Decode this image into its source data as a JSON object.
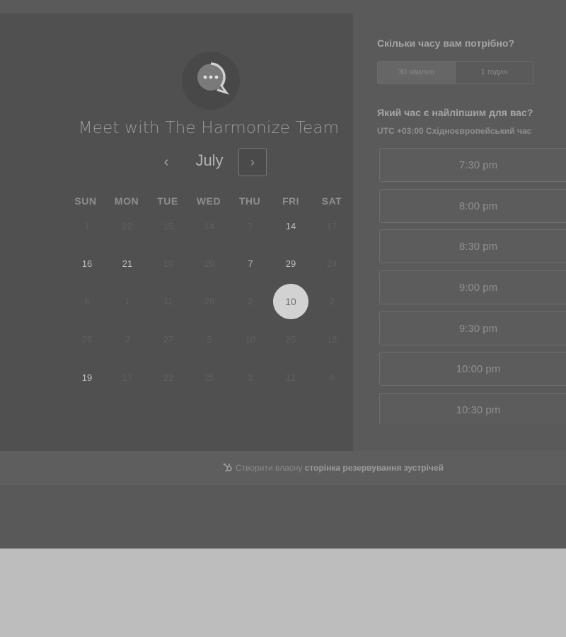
{
  "colors": {
    "left_panel_bg": "#505050",
    "right_panel_bg": "#5a5a5a",
    "selected_day_bg": "#d2d2d2",
    "page_bg": "#bdbdbd"
  },
  "logo": {
    "icon": "chat-bubble-icon"
  },
  "meeting": {
    "title": "Meet with The Harmonize Team"
  },
  "calendar": {
    "month": "July",
    "prev_icon": "chevron-left-icon",
    "next_icon": "chevron-right-icon",
    "prev_glyph": "‹",
    "next_glyph": "›",
    "weekdays": [
      "SUN",
      "MON",
      "TUE",
      "WED",
      "THU",
      "FRI",
      "SAT"
    ],
    "weeks": [
      [
        {
          "label": "1",
          "state": "unavailable"
        },
        {
          "label": "22",
          "state": "unavailable"
        },
        {
          "label": "15",
          "state": "unavailable"
        },
        {
          "label": "14",
          "state": "unavailable"
        },
        {
          "label": "7",
          "state": "unavailable"
        },
        {
          "label": "14",
          "state": "available"
        },
        {
          "label": "17",
          "state": "unavailable"
        }
      ],
      [
        {
          "label": "16",
          "state": "available"
        },
        {
          "label": "21",
          "state": "available"
        },
        {
          "label": "10",
          "state": "unavailable"
        },
        {
          "label": "29",
          "state": "unavailable"
        },
        {
          "label": "7",
          "state": "available"
        },
        {
          "label": "29",
          "state": "available"
        },
        {
          "label": "24",
          "state": "unavailable"
        }
      ],
      [
        {
          "label": "6",
          "state": "unavailable"
        },
        {
          "label": "1",
          "state": "unavailable"
        },
        {
          "label": "11",
          "state": "unavailable"
        },
        {
          "label": "28",
          "state": "unavailable"
        },
        {
          "label": "2",
          "state": "unavailable"
        },
        {
          "label": "10",
          "state": "selected"
        },
        {
          "label": "2",
          "state": "unavailable"
        }
      ],
      [
        {
          "label": "26",
          "state": "unavailable"
        },
        {
          "label": "2",
          "state": "unavailable"
        },
        {
          "label": "27",
          "state": "unavailable"
        },
        {
          "label": "5",
          "state": "unavailable"
        },
        {
          "label": "10",
          "state": "unavailable"
        },
        {
          "label": "25",
          "state": "unavailable"
        },
        {
          "label": "18",
          "state": "unavailable"
        }
      ],
      [
        {
          "label": "19",
          "state": "available"
        },
        {
          "label": "17",
          "state": "unavailable"
        },
        {
          "label": "22",
          "state": "unavailable"
        },
        {
          "label": "25",
          "state": "unavailable"
        },
        {
          "label": "3",
          "state": "unavailable"
        },
        {
          "label": "12",
          "state": "unavailable"
        },
        {
          "label": "4",
          "state": "unavailable"
        }
      ]
    ]
  },
  "duration": {
    "heading": "Скільки часу вам потрібно?",
    "options": [
      "30 хвилин",
      "1 годин"
    ],
    "selected": "30 хвилин"
  },
  "times": {
    "heading": "Який час є найліпшим для вас?",
    "timezone": "UTC +03:00 Східноєвропейський час",
    "slots": [
      "7:30 pm",
      "8:00 pm",
      "8:30 pm",
      "9:00 pm",
      "9:30 pm",
      "10:00 pm",
      "10:30 pm"
    ]
  },
  "footer": {
    "icon": "hubspot-sprocket-icon",
    "link_prefix": "Створити власну",
    "link_bold": "сторінка резервування зустрічей"
  }
}
